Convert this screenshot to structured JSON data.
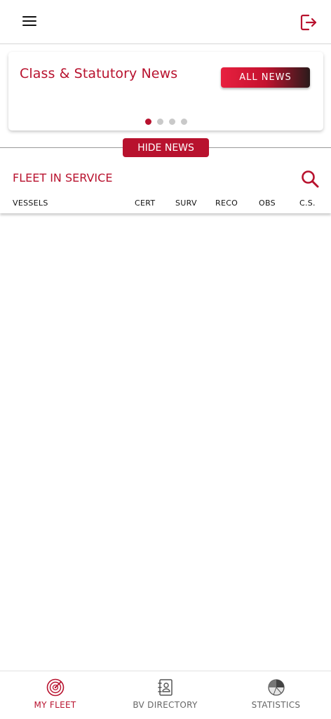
{
  "header": {
    "menu_icon": "hamburger-menu-icon",
    "logout_icon": "logout-icon"
  },
  "news": {
    "title": "Class & Statutory News",
    "all_news_label": "ALL NEWS",
    "carousel": {
      "count": 4,
      "active_index": 0
    },
    "hide_label": "HIDE NEWS"
  },
  "fleet": {
    "title": "FLEET IN SERVICE",
    "search_icon": "search-icon",
    "columns": [
      "VESSELS",
      "CERT",
      "SURV",
      "RECO",
      "OBS",
      "C.S."
    ]
  },
  "bottom_nav": {
    "items": [
      {
        "label": "MY FLEET",
        "icon": "radar-icon",
        "active": true
      },
      {
        "label": "BV DIRECTORY",
        "icon": "contact-book-icon",
        "active": false
      },
      {
        "label": "STATISTICS",
        "icon": "pie-chart-icon",
        "active": false
      }
    ]
  },
  "colors": {
    "brand_red": "#b8122e",
    "inactive_gray": "#666666"
  }
}
